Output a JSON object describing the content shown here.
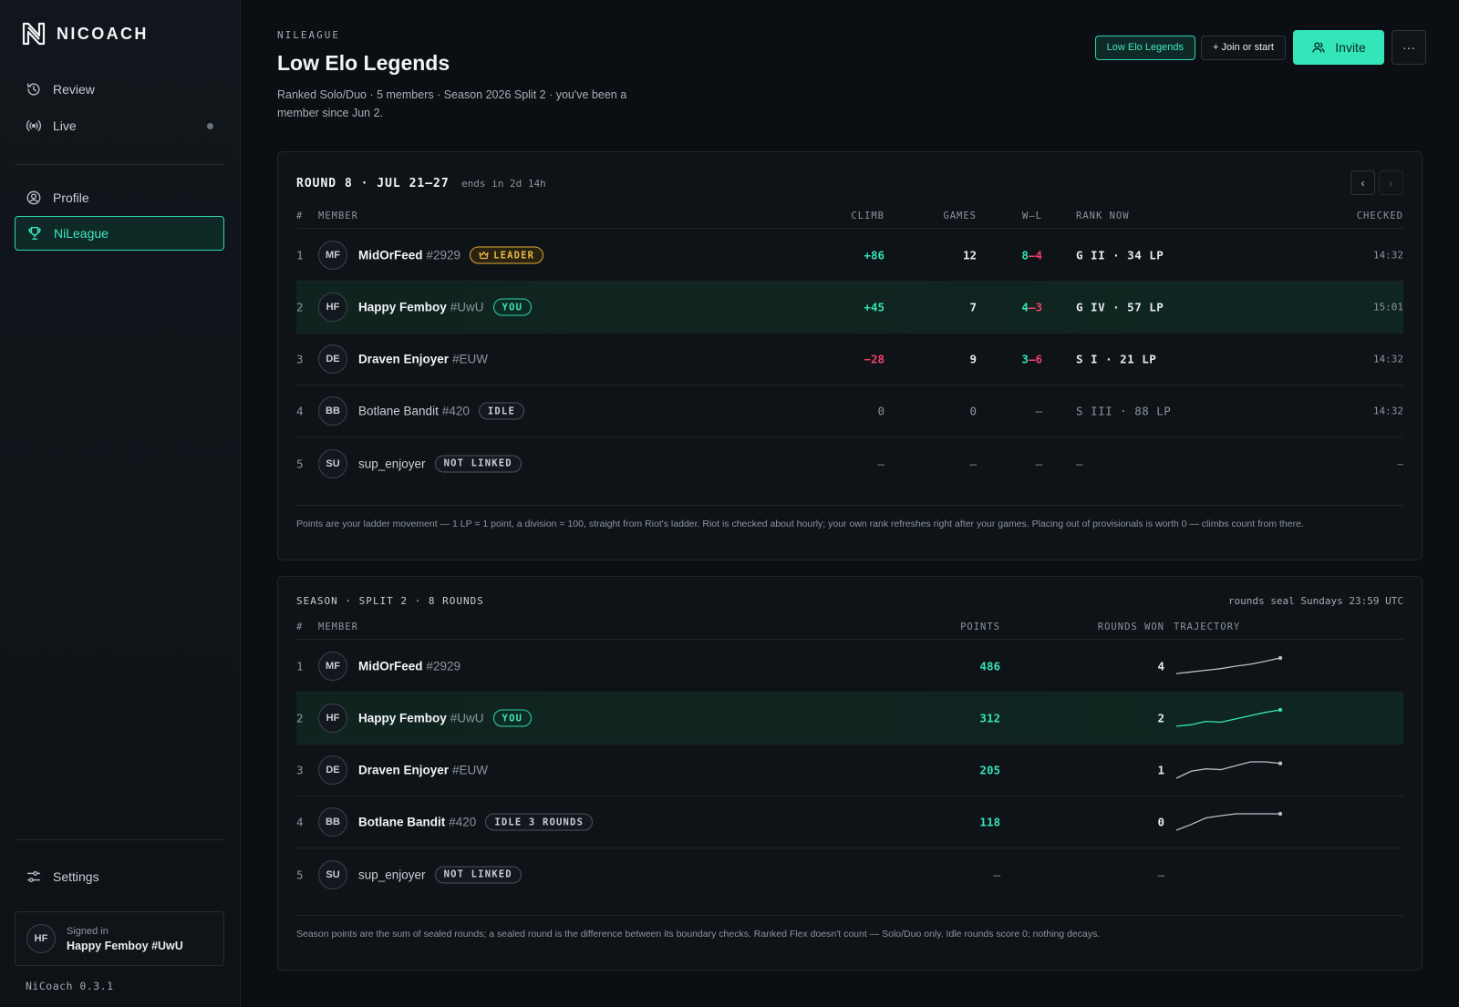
{
  "app": {
    "brand": "NICOACH",
    "version": "NiCoach 0.3.1"
  },
  "sidebar": {
    "items": [
      {
        "label": "Review",
        "icon": "history-icon"
      },
      {
        "label": "Live",
        "icon": "broadcast-icon"
      },
      {
        "label": "Profile",
        "icon": "user-circle-icon"
      },
      {
        "label": "NiLeague",
        "icon": "trophy-icon"
      },
      {
        "label": "Settings",
        "icon": "sliders-icon"
      }
    ],
    "user": {
      "label": "Signed in",
      "name": "Happy Femboy #UwU",
      "initials": "HF"
    }
  },
  "header": {
    "eyebrow": "NILEAGUE",
    "title": "Low Elo Legends",
    "subtitle": "Ranked Solo/Duo · 5 members · Season 2026 Split 2 · you've been a member since Jun 2.",
    "league_chip": "Low Elo Legends",
    "join_label": "+ Join or start",
    "invite_label": "Invite",
    "more_label": "···"
  },
  "round": {
    "title": "ROUND 8 · JUL 21–27",
    "ends": "ends in 2d 14h",
    "prev": "‹",
    "next": "›",
    "columns": {
      "num": "#",
      "member": "MEMBER",
      "climb": "CLIMB",
      "games": "GAMES",
      "wl": "W–L",
      "rank": "RANK NOW",
      "checked": "CHECKED"
    },
    "rows": [
      {
        "pos": "1",
        "initials": "MF",
        "name": "MidOrFeed",
        "tag": "#2929",
        "badge": "LEADER",
        "climb": "+86",
        "games": "12",
        "wins": "8",
        "sep": "–",
        "losses": "4",
        "rank": "G II · 34 LP",
        "checked": "14:32"
      },
      {
        "pos": "2",
        "initials": "HF",
        "name": "Happy Femboy",
        "tag": "#UwU",
        "badge": "YOU",
        "climb": "+45",
        "games": "7",
        "wins": "4",
        "sep": "–",
        "losses": "3",
        "rank": "G IV · 57 LP",
        "checked": "15:01"
      },
      {
        "pos": "3",
        "initials": "DE",
        "name": "Draven Enjoyer",
        "tag": "#EUW",
        "badge": "",
        "climb": "−28",
        "games": "9",
        "wins": "3",
        "sep": "–",
        "losses": "6",
        "rank": "S I · 21 LP",
        "checked": "14:32"
      },
      {
        "pos": "4",
        "initials": "BB",
        "name": "Botlane Bandit",
        "tag": "#420",
        "badge": "IDLE",
        "climb": "0",
        "games": "0",
        "wl": "–",
        "rank": "S III · 88 LP",
        "checked": "14:32"
      },
      {
        "pos": "5",
        "initials": "SU",
        "name": "sup_enjoyer",
        "tag": "",
        "badge": "NOT LINKED",
        "climb": "–",
        "games": "–",
        "wl": "–",
        "rank": "–",
        "checked": "–"
      }
    ],
    "footnote": "Points are your ladder movement — 1 LP = 1 point, a division = 100, straight from Riot's ladder. Riot is checked about hourly; your own rank refreshes right after your games. Placing out of provisionals is worth 0 — climbs count from there."
  },
  "season": {
    "title": "SEASON · SPLIT 2 · 8 ROUNDS",
    "note": "rounds seal Sundays 23:59 UTC",
    "columns": {
      "num": "#",
      "member": "MEMBER",
      "points": "POINTS",
      "won": "ROUNDS WON",
      "trajectory": "TRAJECTORY"
    },
    "rows": [
      {
        "pos": "1",
        "initials": "MF",
        "name": "MidOrFeed",
        "tag": "#2929",
        "badge": "",
        "points": "486",
        "won": "4",
        "trajectory": [
          0.05,
          0.15,
          0.25,
          0.35,
          0.5,
          0.62,
          0.8,
          1.0
        ]
      },
      {
        "pos": "2",
        "initials": "HF",
        "name": "Happy Femboy",
        "tag": "#UwU",
        "badge": "YOU",
        "points": "312",
        "won": "2",
        "trajectory": [
          0.0,
          0.1,
          0.3,
          0.25,
          0.45,
          0.65,
          0.85,
          1.0
        ]
      },
      {
        "pos": "3",
        "initials": "DE",
        "name": "Draven Enjoyer",
        "tag": "#EUW",
        "badge": "",
        "points": "205",
        "won": "1",
        "trajectory": [
          0.0,
          0.45,
          0.6,
          0.55,
          0.8,
          1.05,
          1.05,
          0.95
        ]
      },
      {
        "pos": "4",
        "initials": "BB",
        "name": "Botlane Bandit",
        "tag": "#420",
        "badge": "IDLE 3 ROUNDS",
        "points": "118",
        "won": "0",
        "trajectory": [
          0.0,
          0.35,
          0.75,
          0.88,
          1.0,
          1.0,
          1.0,
          1.0
        ]
      },
      {
        "pos": "5",
        "initials": "SU",
        "name": "sup_enjoyer",
        "tag": "",
        "badge": "NOT LINKED",
        "points": "–",
        "won": "–",
        "trajectory": []
      }
    ],
    "footnote": "Season points are the sum of sealed rounds; a sealed round is the difference between its boundary checks. Ranked Flex doesn't count — Solo/Duo only. Idle rounds score 0; nothing decays."
  },
  "colors": {
    "accent": "#34e5b9",
    "negative": "#f23f6b",
    "leader": "#e9b949",
    "background": "#0b0e12"
  }
}
